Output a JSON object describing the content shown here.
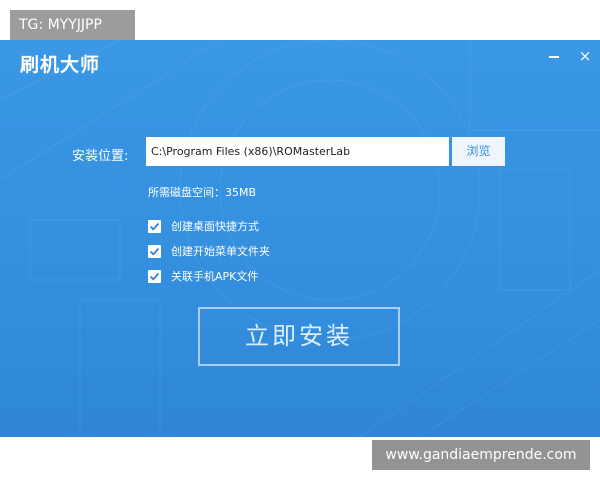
{
  "watermarks": {
    "top_left": "TG: MYYJJPP",
    "bottom_right": "www.gandiaemprende.com"
  },
  "window": {
    "title": "刷机大师",
    "close_glyph": "×",
    "accent_color": "#3a98e6"
  },
  "install": {
    "path_label": "安装位置:",
    "path_value": "C:\\Program Files (x86)\\ROMasterLab",
    "browse_label": "浏览",
    "space_text": "所需磁盘空间：35MB",
    "options": [
      {
        "label": "创建桌面快捷方式",
        "checked": true
      },
      {
        "label": "创建开始菜单文件夹",
        "checked": true
      },
      {
        "label": "关联手机APK文件",
        "checked": true
      }
    ],
    "install_button": "立即安装"
  }
}
